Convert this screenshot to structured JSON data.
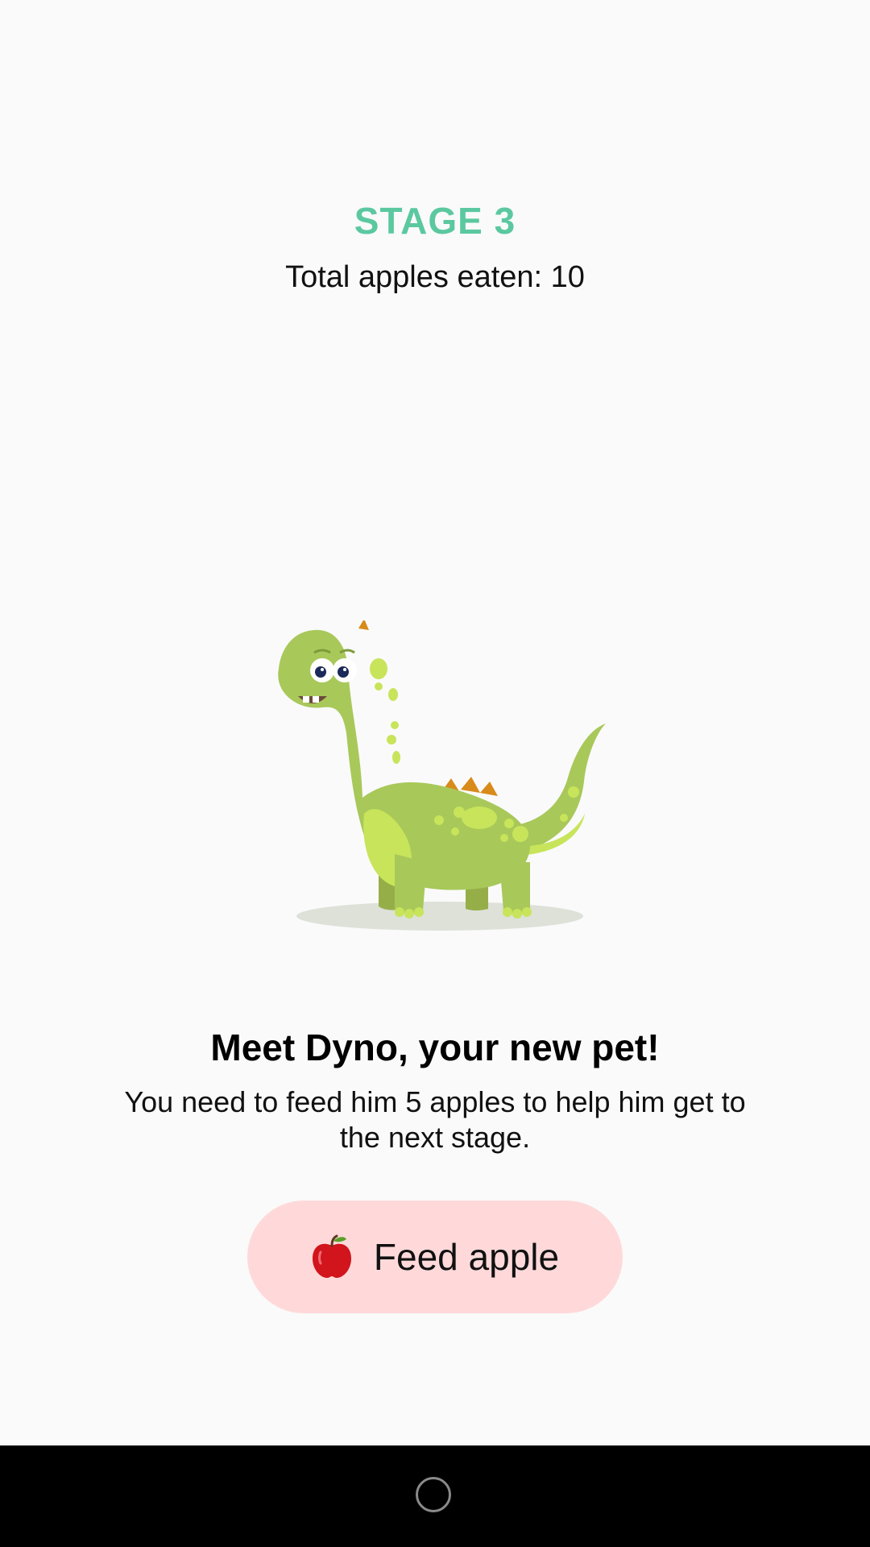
{
  "stage": {
    "title": "STAGE 3",
    "apples_eaten_text": "Total apples eaten: 10"
  },
  "pet": {
    "icon": "dinosaur-illustration"
  },
  "intro": {
    "title": "Meet Dyno, your new pet!",
    "description": "You need to feed him 5 apples to help him get to the next stage."
  },
  "feed_button": {
    "icon": "apple-icon",
    "label": "Feed apple"
  },
  "colors": {
    "accent": "#5BC8A0",
    "button_bg": "#FFD9DA",
    "background": "#FAFAFA",
    "nav_bar": "#000000"
  },
  "nav": {
    "home_icon": "home-circle-icon"
  }
}
